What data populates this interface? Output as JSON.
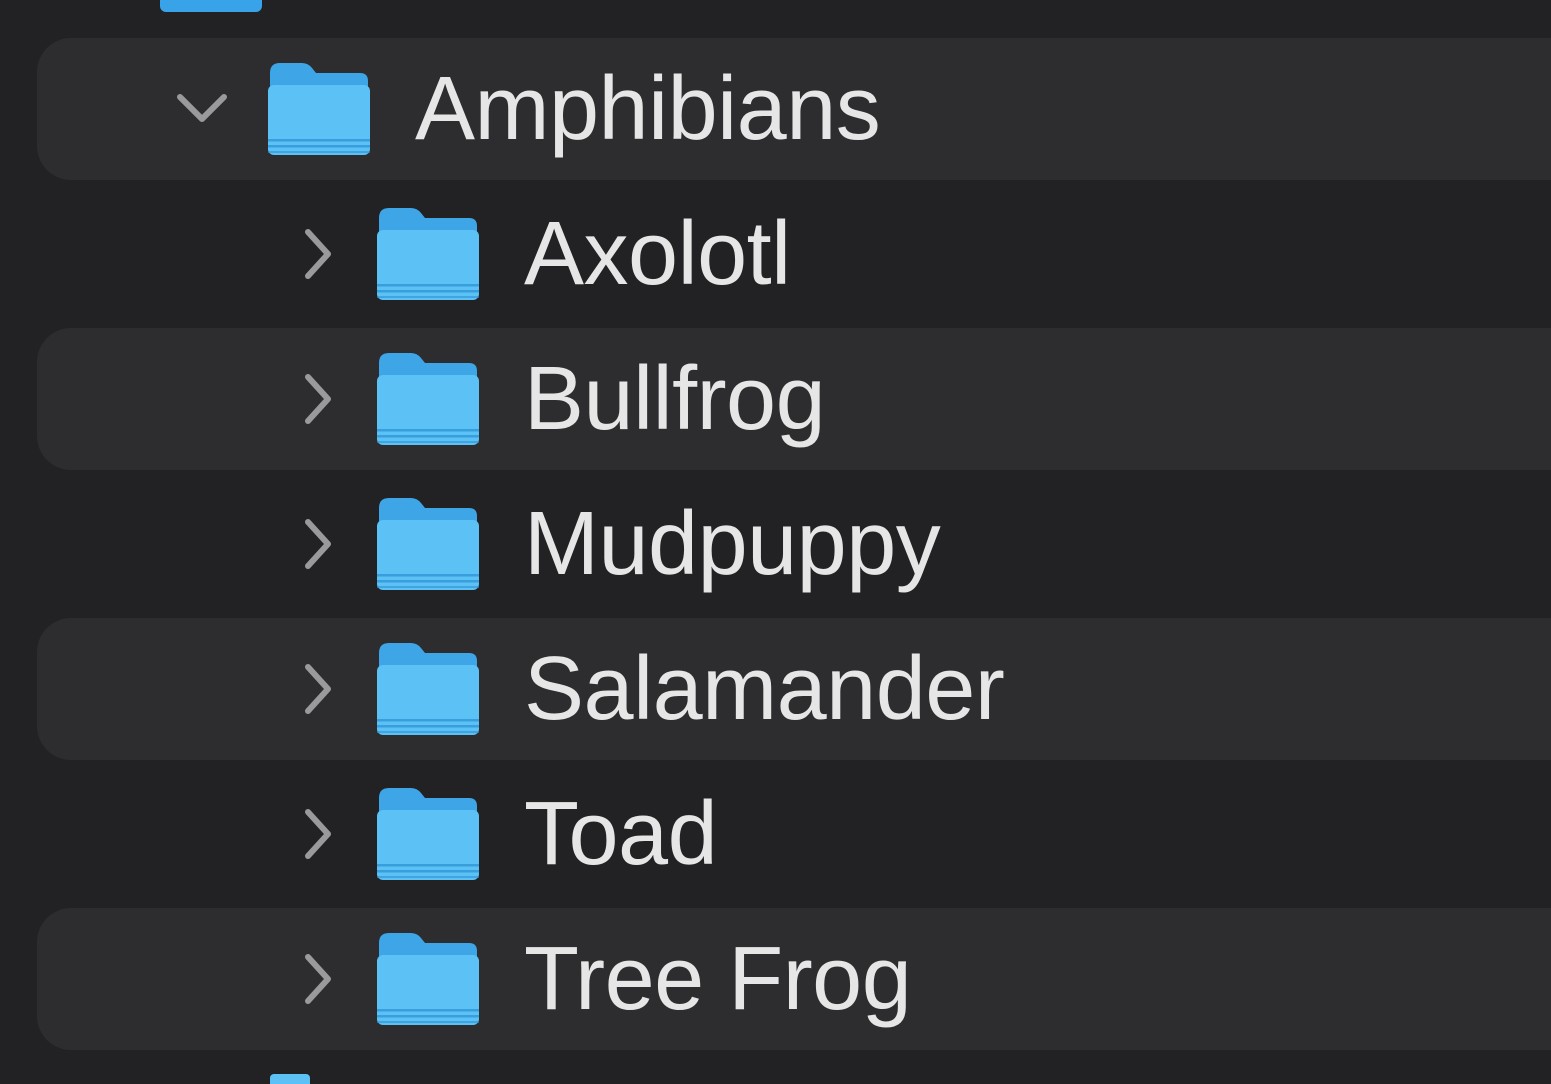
{
  "parent": {
    "label": "Amphibians",
    "icon": "folder-icon",
    "disclosure": "chevron-down-icon",
    "expanded": true
  },
  "children": [
    {
      "label": "Axolotl",
      "icon": "folder-icon",
      "disclosure": "chevron-right-icon"
    },
    {
      "label": "Bullfrog",
      "icon": "folder-icon",
      "disclosure": "chevron-right-icon"
    },
    {
      "label": "Mudpuppy",
      "icon": "folder-icon",
      "disclosure": "chevron-right-icon"
    },
    {
      "label": "Salamander",
      "icon": "folder-icon",
      "disclosure": "chevron-right-icon"
    },
    {
      "label": "Toad",
      "icon": "folder-icon",
      "disclosure": "chevron-right-icon"
    },
    {
      "label": "Tree Frog",
      "icon": "folder-icon",
      "disclosure": "chevron-right-icon"
    }
  ],
  "colors": {
    "background": "#222224",
    "stripe": "#2d2d2f",
    "text": "#e6e6e6",
    "chevron": "#9a9a9c",
    "folder_body": "#5cc2f6",
    "folder_back": "#3ea6e6",
    "folder_lines": "#2b8fd2"
  }
}
